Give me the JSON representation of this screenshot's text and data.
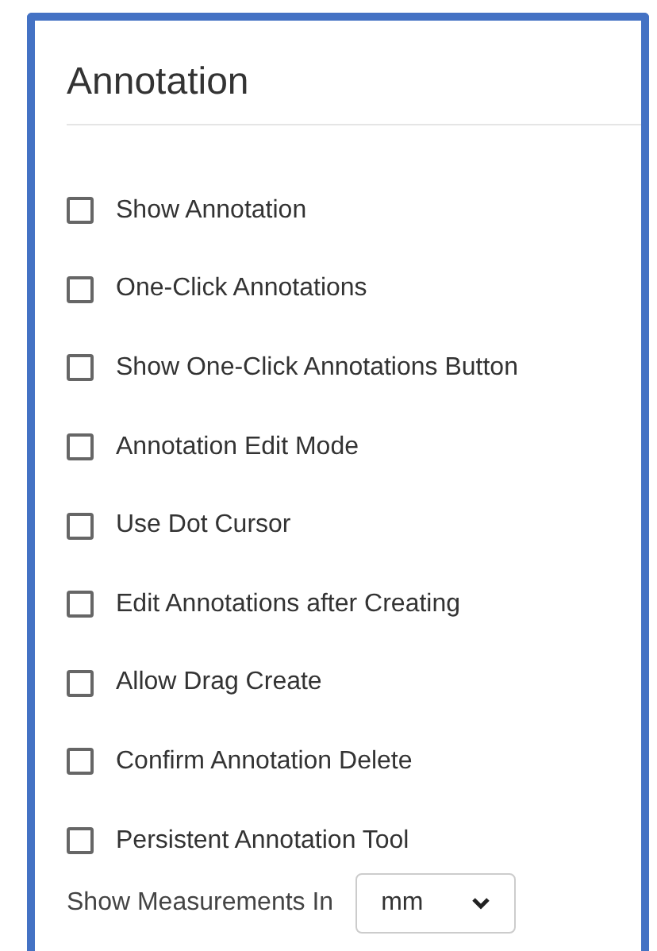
{
  "panel": {
    "title": "Annotation"
  },
  "options": [
    {
      "label": "Show Annotation",
      "checked": false
    },
    {
      "label": "One-Click Annotations",
      "checked": false
    },
    {
      "label": "Show One-Click Annotations Button",
      "checked": false
    },
    {
      "label": "Annotation Edit Mode",
      "checked": false
    },
    {
      "label": "Use Dot Cursor",
      "checked": false
    },
    {
      "label": "Edit Annotations after Creating",
      "checked": false
    },
    {
      "label": "Allow Drag Create",
      "checked": false
    },
    {
      "label": "Confirm Annotation Delete",
      "checked": false
    },
    {
      "label": "Persistent Annotation Tool",
      "checked": false
    }
  ],
  "measurement": {
    "label": "Show Measurements In",
    "value": "mm"
  }
}
